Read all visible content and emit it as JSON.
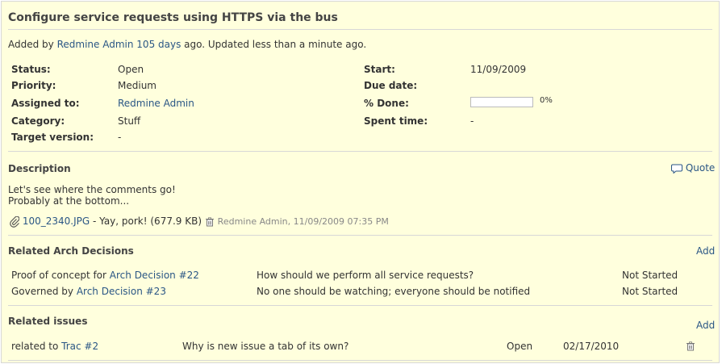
{
  "issue": {
    "title": "Configure service requests using HTTPS via the bus",
    "added_prefix": "Added by",
    "author": "Redmine Admin",
    "age": "105 days",
    "added_suffix": "ago. Updated less than a minute ago.",
    "fields_left": [
      {
        "label": "Status:",
        "value": "Open",
        "link": false
      },
      {
        "label": "Priority:",
        "value": "Medium",
        "link": false
      },
      {
        "label": "Assigned to:",
        "value": "Redmine Admin",
        "link": true
      },
      {
        "label": "Category:",
        "value": "Stuff",
        "link": false
      },
      {
        "label": "Target version:",
        "value": "-",
        "link": false
      }
    ],
    "fields_right": {
      "start_label": "Start:",
      "start_value": "11/09/2009",
      "due_label": "Due date:",
      "due_value": "",
      "done_label": "% Done:",
      "done_value": "0%",
      "done_fraction": 0,
      "spent_label": "Spent time:",
      "spent_value": "-"
    },
    "description": {
      "heading": "Description",
      "quote_label": "Quote",
      "lines": [
        "Let's see where the comments go!",
        "Probably at the bottom..."
      ]
    },
    "attachment": {
      "filename": "100_2340.JPG",
      "caption": "- Yay, pork! (677.9 KB)",
      "meta": "Redmine Admin, 11/09/2009 07:35 PM"
    },
    "arch_decisions": {
      "heading": "Related Arch Decisions",
      "add_label": "Add",
      "rows": [
        {
          "relation": "Proof of concept for",
          "link": "Arch Decision #22",
          "subject": "How should we perform all service requests?",
          "status": "Not Started"
        },
        {
          "relation": "Governed by",
          "link": "Arch Decision #23",
          "subject": "No one should be watching; everyone should be notified",
          "status": "Not Started"
        }
      ]
    },
    "related_issues": {
      "heading": "Related issues",
      "add_label": "Add",
      "rows": [
        {
          "relation": "related to",
          "link": "Trac #2",
          "subject": "Why is new issue a tab of its own?",
          "status": "Open",
          "date": "02/17/2010"
        }
      ]
    },
    "colors": {
      "link": "#2a5685",
      "background": "#ffffdd",
      "border": "#d7d7d7"
    }
  }
}
